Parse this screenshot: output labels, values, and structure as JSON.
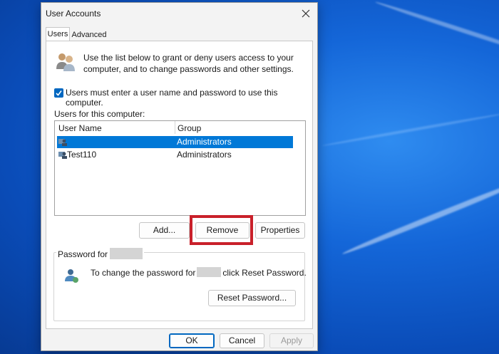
{
  "window": {
    "title": "User Accounts"
  },
  "tabs": [
    {
      "label": "Users",
      "active": true
    },
    {
      "label": "Advanced",
      "active": false
    }
  ],
  "intro": {
    "line1": "Use the list below to grant or deny users access to your",
    "line2": "computer, and to change passwords and other settings."
  },
  "require_login": {
    "checked": true,
    "label": "Users must enter a user name and password to use this computer."
  },
  "users_section": {
    "label": "Users for this computer:",
    "columns": [
      "User Name",
      "Group"
    ],
    "rows": [
      {
        "name": "",
        "group": "Administrators",
        "selected": true
      },
      {
        "name": "Test110",
        "group": "Administrators",
        "selected": false
      }
    ]
  },
  "list_buttons": {
    "add": "Add...",
    "remove": "Remove",
    "properties": "Properties"
  },
  "password_section": {
    "label": "Password for",
    "text_before": "To change the password for",
    "text_after": "click Reset Password.",
    "reset_button": "Reset Password..."
  },
  "footer": {
    "ok": "OK",
    "cancel": "Cancel",
    "apply": "Apply"
  },
  "colors": {
    "selection": "#0078d7",
    "highlight_box": "#c9202a",
    "checkbox": "#0067c0",
    "desktop": "#1466d8"
  }
}
